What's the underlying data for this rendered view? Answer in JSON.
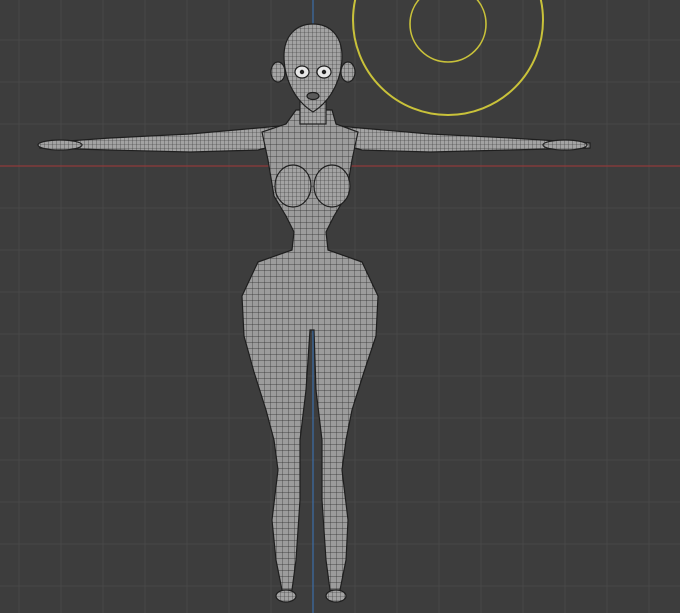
{
  "viewport": {
    "view": "front-orthographic",
    "colors": {
      "background": "#3d3d3d",
      "grid_minor": "#474747",
      "grid_major": "#4b4b4b",
      "axis_x": "#8e3b3b",
      "axis_z": "#3c6ea8",
      "light_gizmo": "#c9c23a",
      "mesh_fill": "#9a9a9a",
      "mesh_wire": "#2b2b2b",
      "mesh_edge": "#1e1e1e"
    },
    "objects": [
      {
        "name": "character-mesh",
        "type": "mesh",
        "icon": "mesh-object-icon"
      },
      {
        "name": "light-gizmo",
        "type": "light",
        "icon": "light-icon"
      }
    ]
  }
}
